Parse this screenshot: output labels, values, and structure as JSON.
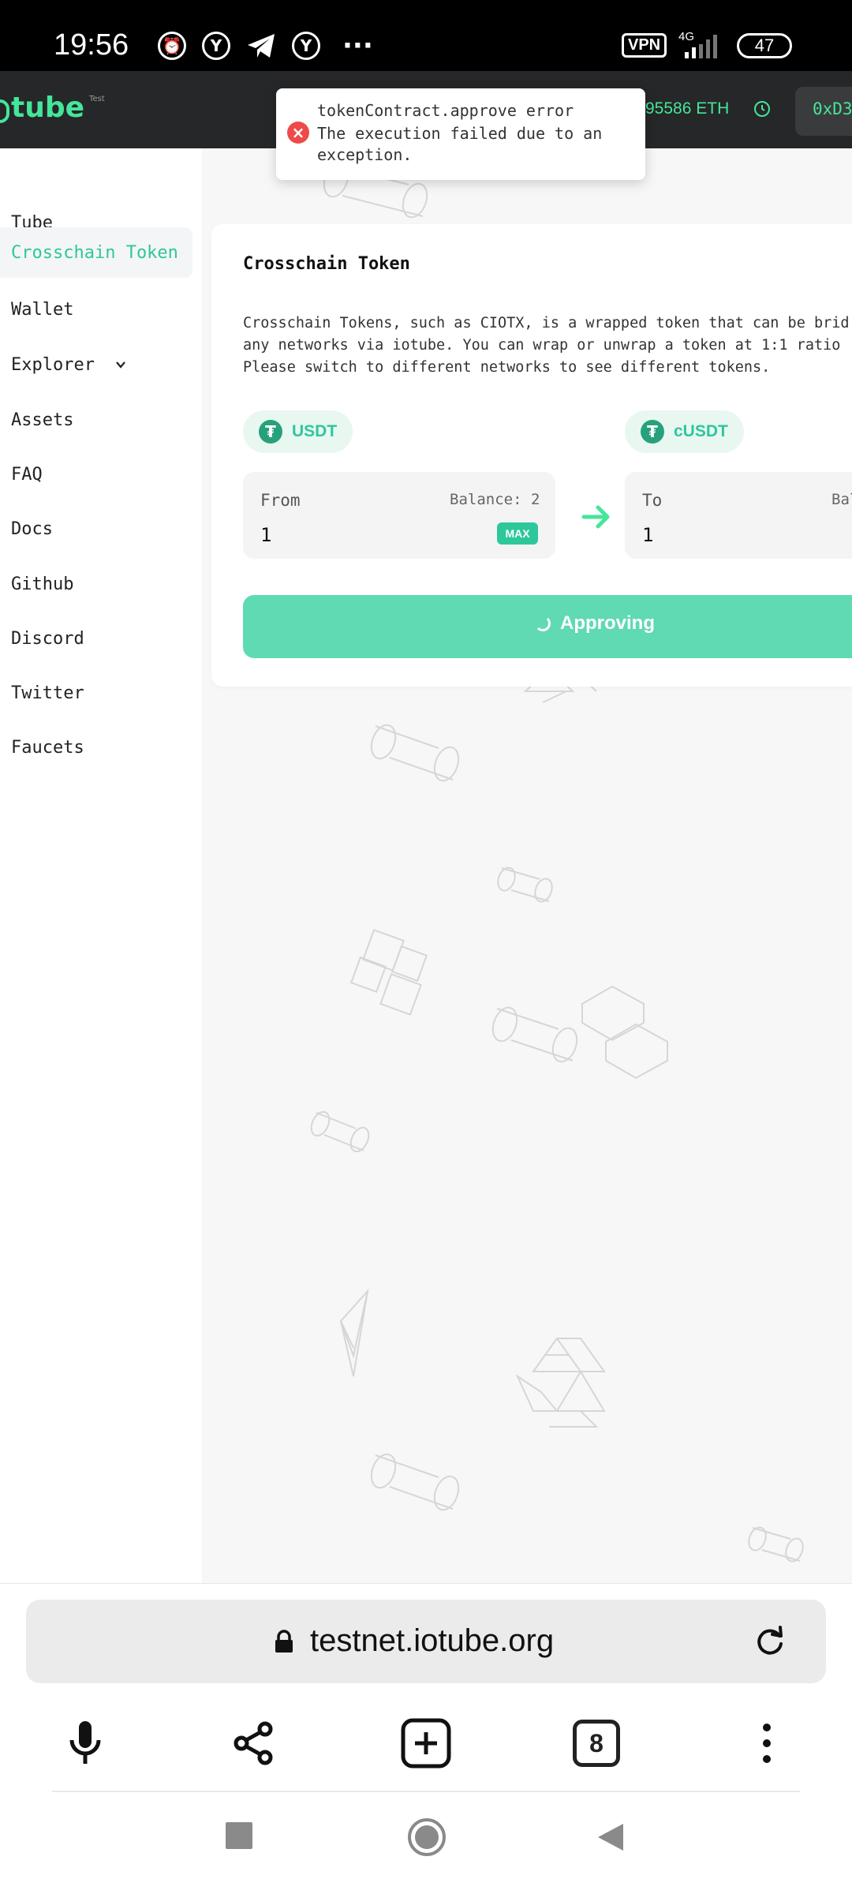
{
  "status_bar": {
    "time": "19:56",
    "vpn": "VPN",
    "network": "4G",
    "battery": "47"
  },
  "header": {
    "logo": "tube",
    "logo_tag": "Test",
    "balance": "95586 ETH",
    "address": "0xD3"
  },
  "sidebar": {
    "items": [
      {
        "label": "Tube"
      },
      {
        "label": "Crosschain Token",
        "active": true
      },
      {
        "label": "Wallet"
      },
      {
        "label": "Explorer"
      },
      {
        "label": "Assets"
      },
      {
        "label": "FAQ"
      },
      {
        "label": "Docs"
      },
      {
        "label": "Github"
      },
      {
        "label": "Discord"
      },
      {
        "label": "Twitter"
      },
      {
        "label": "Faucets"
      }
    ]
  },
  "card": {
    "title": "Crosschain Token",
    "description": "Crosschain Tokens, such as CIOTX, is a wrapped token that can be brid\nany networks via iotube. You can wrap or unwrap a token at 1:1 ratio\nPlease switch to different networks to see different tokens.",
    "from_token": "USDT",
    "to_token": "cUSDT",
    "from_label": "From",
    "from_balance": "Balance: 2",
    "from_value": "1",
    "max_label": "MAX",
    "to_label": "To",
    "to_balance": "Bal",
    "to_value": "1",
    "button_label": "Approving"
  },
  "toast": {
    "title": "tokenContract.approve error",
    "message": "The execution failed due to an exception."
  },
  "browser": {
    "url": "testnet.iotube.org",
    "tab_count": "8"
  },
  "colors": {
    "accent": "#2ec79b",
    "header_bg": "#262728",
    "error": "#ef4a4a"
  }
}
